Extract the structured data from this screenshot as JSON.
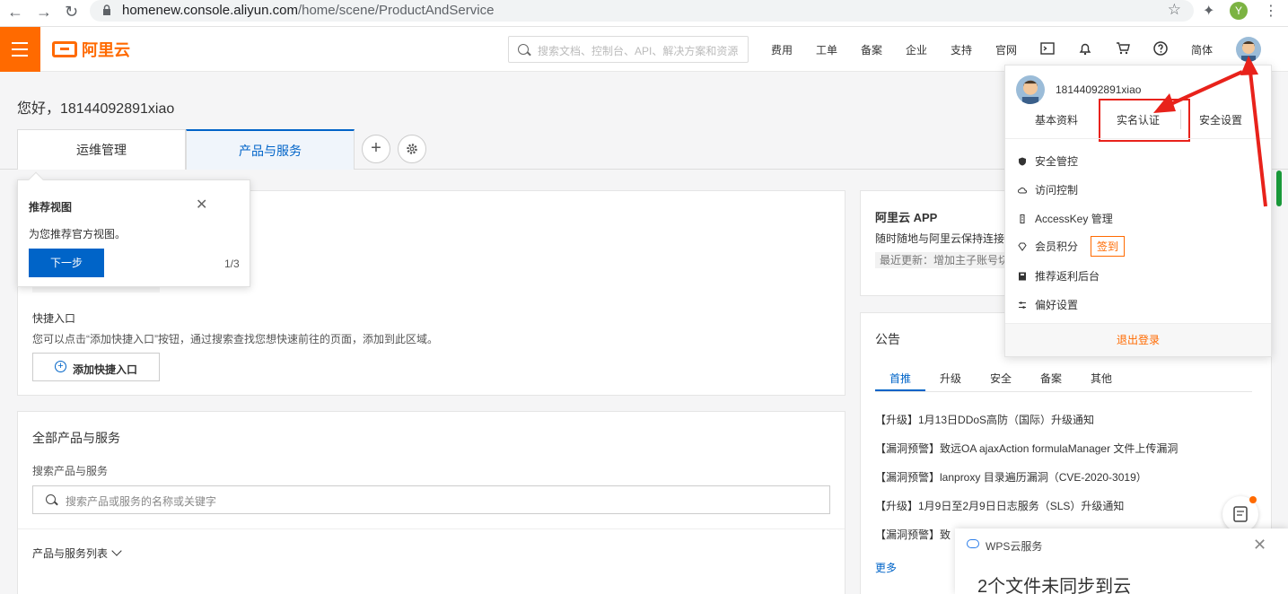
{
  "browser": {
    "url_host": "homenew.console.aliyun.com",
    "url_path": "/home/scene/ProductAndService",
    "profile_initial": "Y"
  },
  "topbar": {
    "logo_text": "阿里云",
    "search_placeholder": "搜索文档、控制台、API、解决方案和资源",
    "nav": [
      "费用",
      "工单",
      "备案",
      "企业",
      "支持",
      "官网"
    ],
    "lang": "简体",
    "brand_color": "#ff6a00"
  },
  "page": {
    "greeting": "您好，18144092891xiao",
    "tabs": [
      "运维管理",
      "产品与服务"
    ],
    "active_tab": "产品与服务"
  },
  "guide": {
    "title": "推荐视图",
    "desc": "为您推荐官方视图。",
    "next_label": "下一步",
    "pager": "1/3"
  },
  "quick": {
    "title": "快捷入口",
    "desc": "您可以点击“添加快捷入口”按钮，通过搜索查找您想快速前往的页面，添加到此区域。",
    "add_label": "添加快捷入口"
  },
  "products": {
    "title": "全部产品与服务",
    "search_label": "搜索产品与服务",
    "search_placeholder": "搜索产品或服务的名称或关键字",
    "list_label": "产品与服务列表"
  },
  "app": {
    "title": "阿里云 APP",
    "desc": "随时随地与阿里云保持连接",
    "update": "最近更新：增加主子账号切换"
  },
  "notice": {
    "title": "公告",
    "tabs": [
      "首推",
      "升级",
      "安全",
      "备案",
      "其他"
    ],
    "active_tab": "首推",
    "items": [
      "【升级】1月13日DDoS高防（国际）升级通知",
      "【漏洞预警】致远OA ajaxAction formulaManager 文件上传漏洞",
      "【漏洞预警】lanproxy 目录遍历漏洞（CVE-2020-3019）",
      "【升级】1月9日至2月9日日志服务（SLS）升级通知",
      "【漏洞预警】致"
    ],
    "more": "更多"
  },
  "user_menu": {
    "username": "18144092891xiao",
    "links": [
      "基本资料",
      "实名认证",
      "安全设置"
    ],
    "items": [
      {
        "label": "安全管控",
        "icon": "shield-icon"
      },
      {
        "label": "访问控制",
        "icon": "cloud-icon"
      },
      {
        "label": "AccessKey 管理",
        "icon": "key-icon"
      },
      {
        "label": "会员积分",
        "icon": "diamond-icon"
      },
      {
        "label": "推荐返利后台",
        "icon": "book-icon"
      },
      {
        "label": "偏好设置",
        "icon": "sliders-icon"
      }
    ],
    "signin_badge": "签到",
    "logout": "退出登录",
    "highlight_color": "#e8221b"
  },
  "wps": {
    "title": "WPS云服务",
    "message": "2个文件未同步到云"
  }
}
